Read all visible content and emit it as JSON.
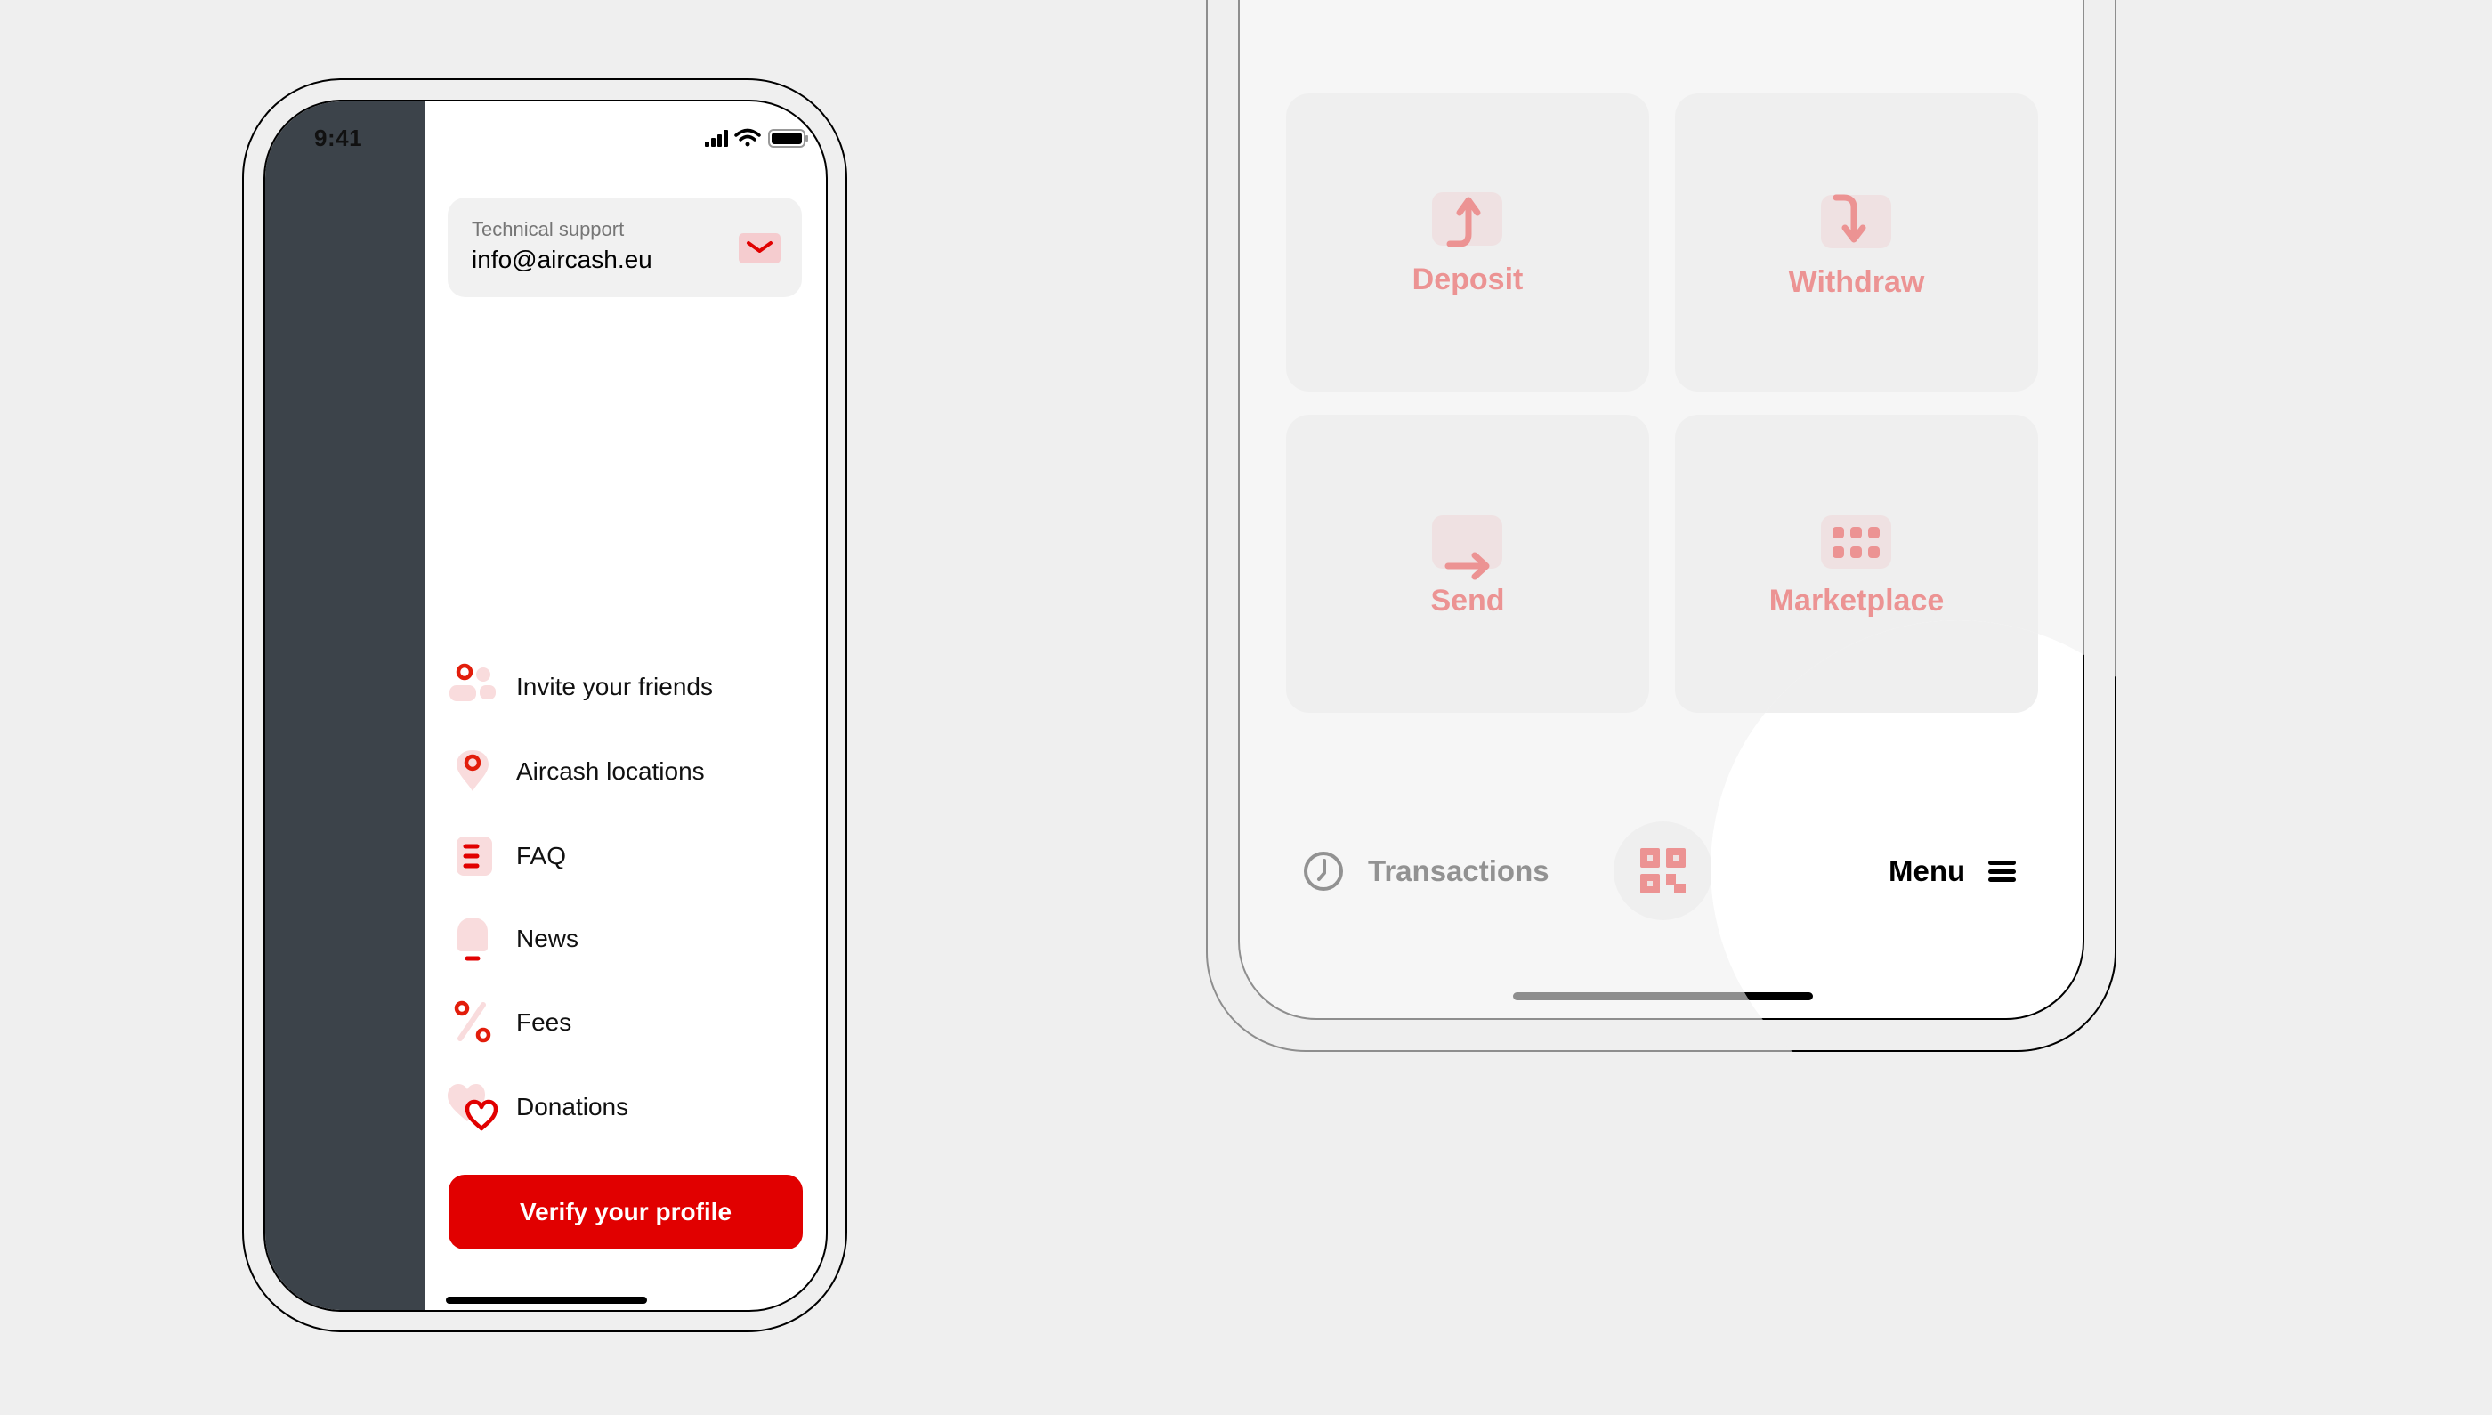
{
  "left_phone": {
    "status_bar": {
      "time": "9:41",
      "icons": [
        "cellular-signal-icon",
        "wifi-icon",
        "battery-icon"
      ]
    },
    "support_card": {
      "label": "Technical support",
      "email": "info@aircash.eu",
      "icon": "mail-icon"
    },
    "menu_items": [
      {
        "label": "Invite your friends",
        "icon": "invite-friends-icon"
      },
      {
        "label": "Aircash locations",
        "icon": "location-pin-icon"
      },
      {
        "label": "FAQ",
        "icon": "faq-list-icon"
      },
      {
        "label": "News",
        "icon": "bell-icon"
      },
      {
        "label": "Fees",
        "icon": "percent-icon"
      },
      {
        "label": "Donations",
        "icon": "heart-icon"
      }
    ],
    "verify_button": "Verify your profile"
  },
  "right_phone": {
    "actions": [
      {
        "label": "Deposit",
        "icon": "deposit-arrow-up-icon"
      },
      {
        "label": "Withdraw",
        "icon": "withdraw-arrow-down-icon"
      },
      {
        "label": "Send",
        "icon": "send-arrow-right-icon"
      },
      {
        "label": "Marketplace",
        "icon": "marketplace-grid-icon"
      }
    ],
    "bottom_nav": {
      "transactions": "Transactions",
      "scan": "qr-code-icon",
      "menu": "Menu"
    }
  },
  "colors": {
    "brand_red": "#e10000",
    "faded_red": "#ec9393",
    "sidebar_dark": "#3c434a",
    "icon_tint": "#f9dcdd"
  }
}
